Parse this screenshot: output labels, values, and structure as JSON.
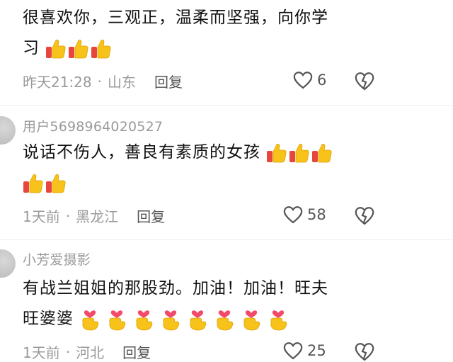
{
  "comments": [
    {
      "username": "",
      "text_line1": "很喜欢你，三观正，温柔而坚强，向你学",
      "text_line2": "习",
      "time": "昨天21:28",
      "location": "山东",
      "reply_label": "回复",
      "likes": "6"
    },
    {
      "username": "用户5698964020527",
      "text_line1": "说话不伤人，善良有素质的女孩",
      "text_line2": "",
      "time": "1天前",
      "location": "黑龙江",
      "reply_label": "回复",
      "likes": "58"
    },
    {
      "username": "小芳爱摄影",
      "text_line1": "有战兰姐姐的那股劲。加油！加油！旺夫",
      "text_line2": "旺婆婆",
      "time": "1天前",
      "location": "河北",
      "reply_label": "回复",
      "likes": "25"
    }
  ],
  "separator": "·",
  "icons": {
    "like": "heart-outline-icon",
    "dislike": "broken-heart-icon",
    "thumbs": "thumbs-up-emoji",
    "heart_hands": "finger-heart-emoji"
  },
  "colors": {
    "meta": "#9a9a9a",
    "text": "#111111",
    "thumb_yellow": "#f7c21a",
    "thumb_red": "#e8453c"
  }
}
